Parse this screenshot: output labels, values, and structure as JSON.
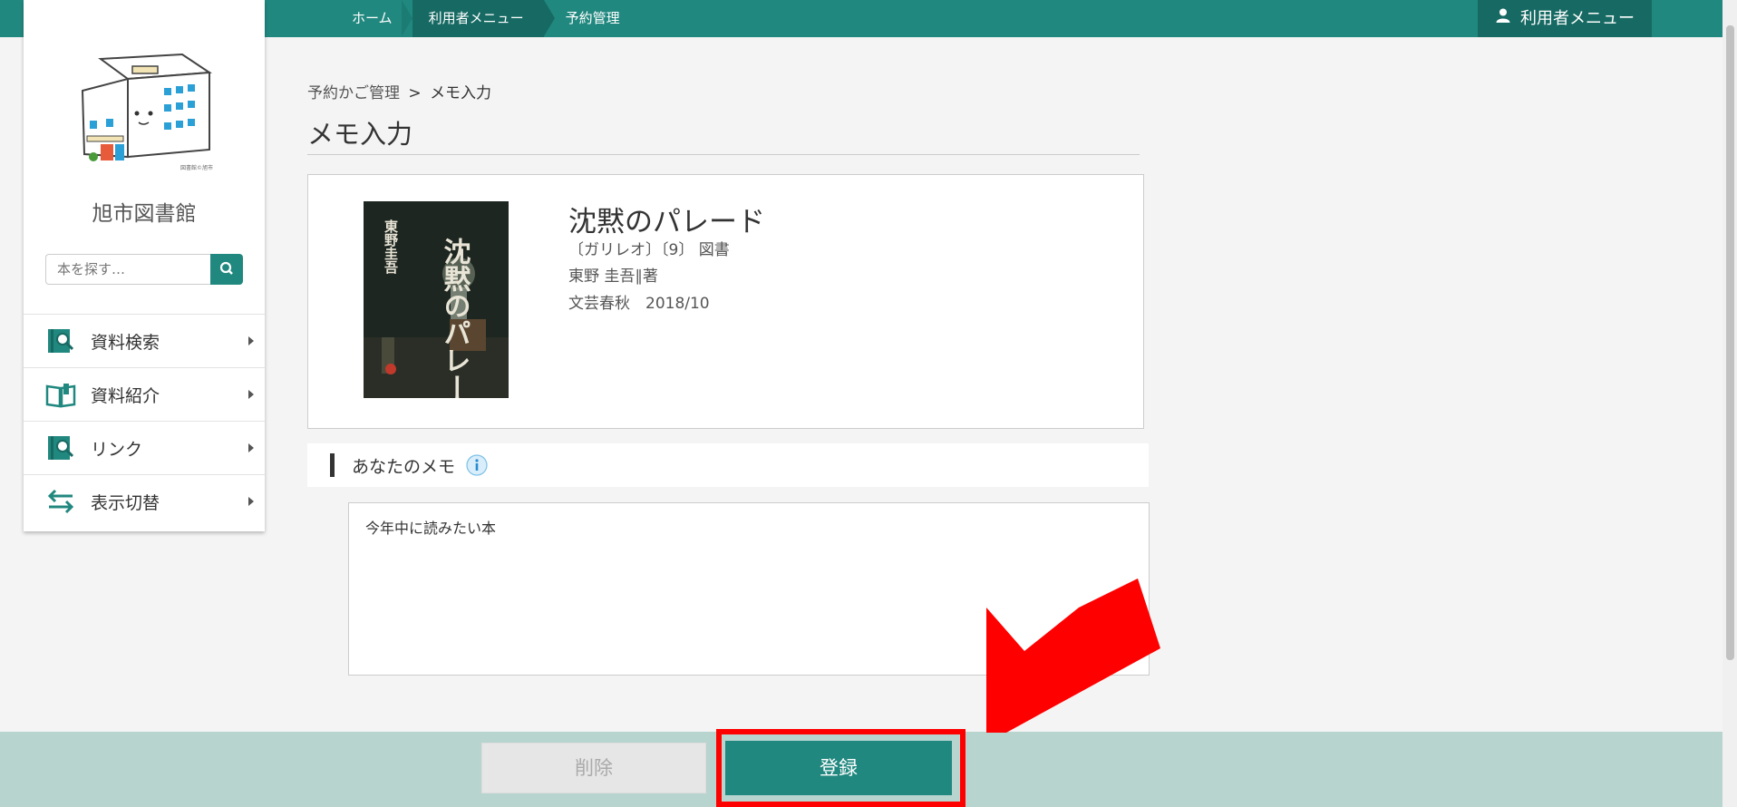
{
  "topnav": {
    "crumbs": [
      {
        "label": "ホーム"
      },
      {
        "label": "利用者メニュー"
      },
      {
        "label": "予約管理"
      }
    ],
    "user_menu_label": "利用者メニュー",
    "user_icon": "person-icon"
  },
  "sidebar": {
    "library_name": "旭市図書館",
    "search": {
      "placeholder": "本を探す…",
      "icon": "search-icon"
    },
    "items": [
      {
        "label": "資料検索",
        "icon": "book-search-icon"
      },
      {
        "label": "資料紹介",
        "icon": "open-book-icon"
      },
      {
        "label": "リンク",
        "icon": "link-search-icon"
      },
      {
        "label": "表示切替",
        "icon": "swap-arrows-icon"
      }
    ]
  },
  "breadcrumb": {
    "parent": "予約かご管理",
    "separator": ">",
    "current": "メモ入力"
  },
  "page_title": "メモ入力",
  "book": {
    "title": "沈黙のパレード",
    "series": "〔ガリレオ〕〔9〕 図書",
    "author": "東野 圭吾∥著",
    "publisher_date": "文芸春秋　2018/10",
    "cover_title": "沈黙のパレード",
    "cover_author": "東野圭吾"
  },
  "memo": {
    "heading": "あなたのメモ",
    "info_icon": "info-icon",
    "value": "今年中に読みたい本"
  },
  "actions": {
    "delete_label": "削除",
    "register_label": "登録"
  },
  "colors": {
    "brand": "#21887f",
    "brand_dark": "#176a63",
    "footer_bg": "#b8d4cf",
    "annotation_red": "#ff0000"
  }
}
